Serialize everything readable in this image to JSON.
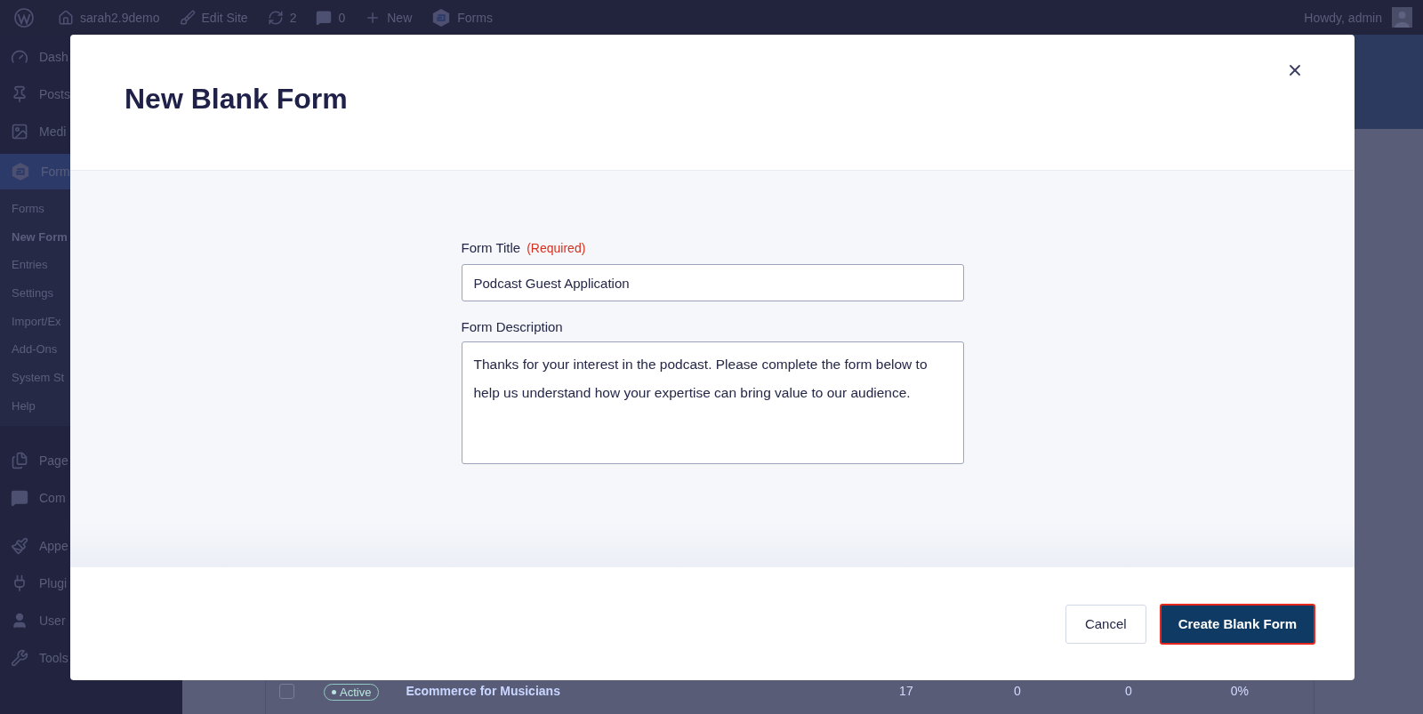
{
  "admin_bar": {
    "items": [
      {
        "kind": "home",
        "label": "sarah2.9demo"
      },
      {
        "kind": "edit",
        "label": "Edit Site"
      },
      {
        "kind": "updates",
        "label": "2"
      },
      {
        "kind": "comments",
        "label": "0"
      },
      {
        "kind": "new",
        "label": "New"
      },
      {
        "kind": "forms",
        "label": "Forms"
      }
    ],
    "greeting": "Howdy, admin"
  },
  "sidebar": {
    "items": [
      {
        "kind": "dashboard",
        "label": "Dash",
        "selected": false
      },
      {
        "kind": "posts",
        "label": "Posts",
        "selected": false
      },
      {
        "kind": "media",
        "label": "Medi",
        "selected": false
      },
      {
        "kind": "forms",
        "label": "Form",
        "selected": true,
        "children": [
          {
            "label": "Forms",
            "selected": false
          },
          {
            "label": "New Form",
            "selected": true
          },
          {
            "label": "Entries",
            "selected": false
          },
          {
            "label": "Settings",
            "selected": false
          },
          {
            "label": "Import/Ex",
            "selected": false
          },
          {
            "label": "Add-Ons",
            "selected": false
          },
          {
            "label": "System St",
            "selected": false
          },
          {
            "label": "Help",
            "selected": false
          }
        ]
      },
      {
        "kind": "pages",
        "label": "Page",
        "selected": false
      },
      {
        "kind": "comments",
        "label": "Com",
        "selected": false
      },
      {
        "kind": "appearance",
        "label": "Appe",
        "selected": false
      },
      {
        "kind": "plugins",
        "label": "Plugi",
        "selected": false
      },
      {
        "kind": "users",
        "label": "User",
        "selected": false
      },
      {
        "kind": "tools",
        "label": "Tools",
        "selected": false
      }
    ]
  },
  "table": {
    "rows": [
      {
        "checked": false,
        "status": "Active",
        "title": "Ecommerce for Musicians",
        "column_3": "17",
        "column_4": "0",
        "column_5": "0",
        "column_6": "0%"
      }
    ]
  },
  "modal": {
    "title": "New Blank Form",
    "fields": [
      {
        "kind": "input",
        "label": "Form Title",
        "required": "(Required)",
        "value": "Podcast Guest Application"
      },
      {
        "kind": "textarea",
        "label": "Form Description",
        "value": "Thanks for your interest in the podcast. Please complete the form below to help us understand how your expertise can bring value to our audience."
      }
    ],
    "buttons": [
      {
        "kind": "secondary",
        "label": "Cancel"
      },
      {
        "kind": "primary",
        "label": "Create Blank Form"
      }
    ]
  }
}
